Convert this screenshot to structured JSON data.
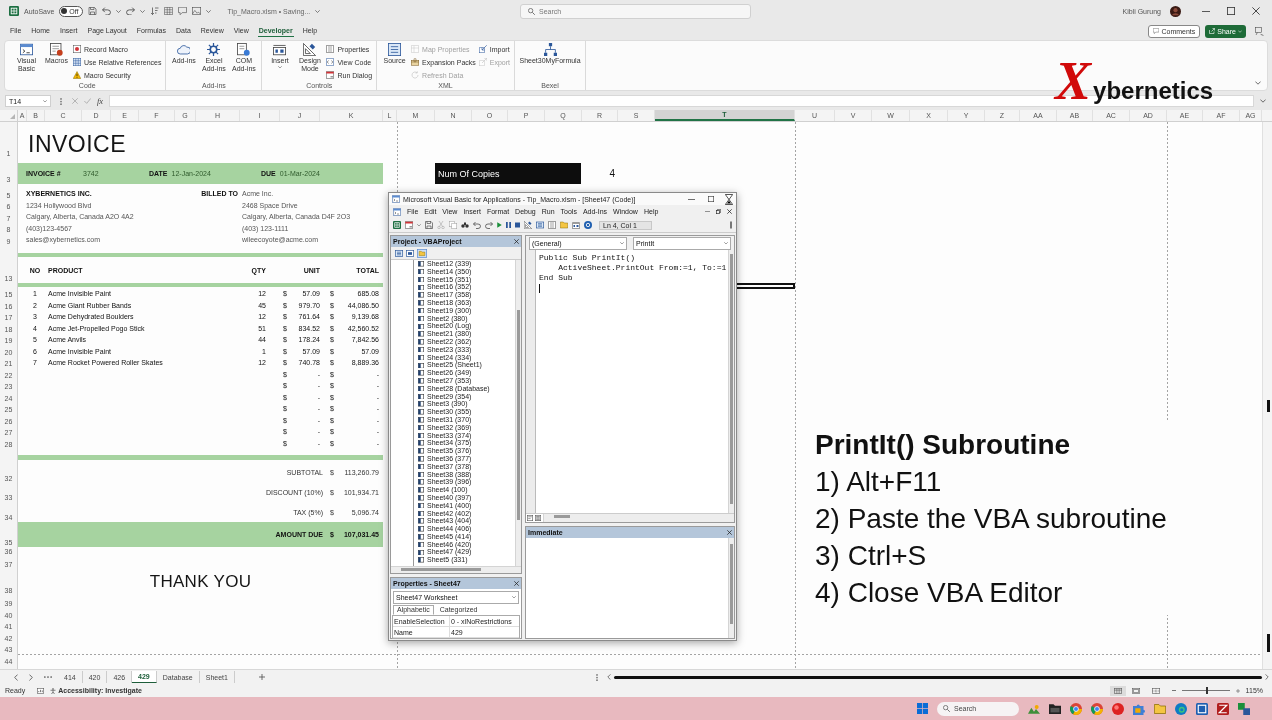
{
  "title_bar": {
    "autosave": {
      "label": "AutoSave",
      "state": "Off",
      "on": false
    },
    "document_title": "Tip_Macro.xlsm • Saving...",
    "search": {
      "placeholder": "Search"
    },
    "user_name": "Kibli Gurung"
  },
  "ribbon": {
    "tabs": [
      {
        "label": "File",
        "selected": false
      },
      {
        "label": "Home",
        "selected": false
      },
      {
        "label": "Insert",
        "selected": false
      },
      {
        "label": "Page Layout",
        "selected": false
      },
      {
        "label": "Formulas",
        "selected": false
      },
      {
        "label": "Data",
        "selected": false
      },
      {
        "label": "Review",
        "selected": false
      },
      {
        "label": "View",
        "selected": false
      },
      {
        "label": "Developer",
        "selected": true
      },
      {
        "label": "Help",
        "selected": false
      }
    ],
    "comments_button": "Comments",
    "share_button": "Share",
    "groups": [
      {
        "label": "Code",
        "items": [
          {
            "kind": "large",
            "label": "Visual Basic",
            "disabled": false
          },
          {
            "kind": "large",
            "label": "Macros",
            "disabled": false
          },
          {
            "kind": "small",
            "label": "Record Macro",
            "disabled": false
          },
          {
            "kind": "small",
            "label": "Use Relative References",
            "disabled": false
          },
          {
            "kind": "small",
            "label": "Macro Security",
            "disabled": false
          }
        ]
      },
      {
        "label": "Add-ins",
        "items": [
          {
            "kind": "large",
            "label": "Add-ins",
            "disabled": false
          },
          {
            "kind": "large",
            "label": "Excel Add-ins",
            "disabled": false
          },
          {
            "kind": "large",
            "label": "COM Add-ins",
            "disabled": false
          }
        ]
      },
      {
        "label": "Controls",
        "items": [
          {
            "kind": "large",
            "label": "Insert",
            "disabled": false
          },
          {
            "kind": "large",
            "label": "Design Mode",
            "disabled": false
          },
          {
            "kind": "small",
            "label": "Properties",
            "disabled": false
          },
          {
            "kind": "small",
            "label": "View Code",
            "disabled": false
          },
          {
            "kind": "small",
            "label": "Run Dialog",
            "disabled": false
          }
        ]
      },
      {
        "label": "XML",
        "items": [
          {
            "kind": "large",
            "label": "Source",
            "disabled": false
          },
          {
            "kind": "small",
            "label": "Map Properties",
            "disabled": true
          },
          {
            "kind": "small",
            "label": "Expansion Packs",
            "disabled": false
          },
          {
            "kind": "small",
            "label": "Refresh Data",
            "disabled": true
          },
          {
            "kind": "small",
            "label": "Import",
            "disabled": false
          },
          {
            "kind": "small",
            "label": "Export",
            "disabled": true
          }
        ]
      },
      {
        "label": "Bexel",
        "items": [
          {
            "kind": "large",
            "label": "Sheet30MyFormula",
            "disabled": false
          }
        ]
      }
    ]
  },
  "formula_bar": {
    "name_box": "T14",
    "function_label": "fx"
  },
  "sheet": {
    "columns": [
      {
        "label": "A",
        "selected": false
      },
      {
        "label": "B",
        "selected": false
      },
      {
        "label": "C",
        "selected": false
      },
      {
        "label": "D",
        "selected": false
      },
      {
        "label": "E",
        "selected": false
      },
      {
        "label": "F",
        "selected": false
      },
      {
        "label": "G",
        "selected": false
      },
      {
        "label": "H",
        "selected": false
      },
      {
        "label": "I",
        "selected": false
      },
      {
        "label": "J",
        "selected": false
      },
      {
        "label": "K",
        "selected": false
      },
      {
        "label": "L",
        "selected": false
      },
      {
        "label": "M",
        "selected": false
      },
      {
        "label": "N",
        "selected": false
      },
      {
        "label": "O",
        "selected": false
      },
      {
        "label": "P",
        "selected": false
      },
      {
        "label": "Q",
        "selected": false
      },
      {
        "label": "R",
        "selected": false
      },
      {
        "label": "S",
        "selected": false
      },
      {
        "label": "T",
        "selected": true
      },
      {
        "label": "U",
        "selected": false
      },
      {
        "label": "V",
        "selected": false
      },
      {
        "label": "W",
        "selected": false
      },
      {
        "label": "X",
        "selected": false
      },
      {
        "label": "Y",
        "selected": false
      },
      {
        "label": "Z",
        "selected": false
      },
      {
        "label": "AA",
        "selected": false
      },
      {
        "label": "AB",
        "selected": false
      },
      {
        "label": "AC",
        "selected": false
      },
      {
        "label": "AD",
        "selected": false
      },
      {
        "label": "AE",
        "selected": false
      },
      {
        "label": "AF",
        "selected": false
      },
      {
        "label": "AG",
        "selected": false
      }
    ],
    "rows": [
      "1",
      "3",
      "5",
      "6",
      "7",
      "8",
      "9",
      "13",
      "15",
      "16",
      "17",
      "18",
      "19",
      "20",
      "21",
      "22",
      "23",
      "24",
      "25",
      "26",
      "27",
      "28",
      "32",
      "33",
      "34",
      "35",
      "36",
      "37",
      "38",
      "39",
      "40",
      "41",
      "42",
      "43",
      "44"
    ],
    "invoice": {
      "title": "INVOICE",
      "meta": [
        {
          "label": "INVOICE #",
          "value": "3742"
        },
        {
          "label": "DATE",
          "value": "12-Jan-2024"
        },
        {
          "label": "DUE",
          "value": "01-Mar-2024"
        }
      ],
      "seller": {
        "name": "XYBERNETICS INC.",
        "lines": [
          "1234 Hollywood Blvd",
          "Calgary, Alberta, Canada A2O 4A2",
          "(403)123-4567",
          "sales@xybernetics.com"
        ]
      },
      "billed_to": {
        "label": "BILLED TO",
        "name": "Acme Inc.",
        "lines": [
          "2468 Space Drive",
          "Calgary, Alberta, Canada D4F 2O3",
          "(403) 123-1111",
          "wileecoyote@acme.com"
        ]
      },
      "columns": [
        "NO",
        "PRODUCT",
        "QTY",
        "UNIT",
        "TOTAL"
      ],
      "items": [
        {
          "no": "1",
          "product": "Acme Invisible Paint",
          "qty": "12",
          "unit_currency": "$",
          "unit": "57.09",
          "total_currency": "$",
          "total": "685.08"
        },
        {
          "no": "2",
          "product": "Acme Giant Rubber Bands",
          "qty": "45",
          "unit_currency": "$",
          "unit": "979.70",
          "total_currency": "$",
          "total": "44,086.50"
        },
        {
          "no": "3",
          "product": "Acme Dehydrated Boulders",
          "qty": "12",
          "unit_currency": "$",
          "unit": "761.64",
          "total_currency": "$",
          "total": "9,139.68"
        },
        {
          "no": "4",
          "product": "Acme Jet-Propelled Pogo Stick",
          "qty": "51",
          "unit_currency": "$",
          "unit": "834.52",
          "total_currency": "$",
          "total": "42,560.52"
        },
        {
          "no": "5",
          "product": "Acme Anvils",
          "qty": "44",
          "unit_currency": "$",
          "unit": "178.24",
          "total_currency": "$",
          "total": "7,842.56"
        },
        {
          "no": "6",
          "product": "Acme Invisible Paint",
          "qty": "1",
          "unit_currency": "$",
          "unit": "57.09",
          "total_currency": "$",
          "total": "57.09"
        },
        {
          "no": "7",
          "product": "Acme Rocket Powered Roller Skates",
          "qty": "12",
          "unit_currency": "$",
          "unit": "740.78",
          "total_currency": "$",
          "total": "8,889.36"
        },
        {
          "unit_currency": "$",
          "unit": "-",
          "total_currency": "$",
          "total": "-"
        },
        {
          "unit_currency": "$",
          "unit": "-",
          "total_currency": "$",
          "total": "-"
        },
        {
          "unit_currency": "$",
          "unit": "-",
          "total_currency": "$",
          "total": "-"
        },
        {
          "unit_currency": "$",
          "unit": "-",
          "total_currency": "$",
          "total": "-"
        },
        {
          "unit_currency": "$",
          "unit": "-",
          "total_currency": "$",
          "total": "-"
        },
        {
          "unit_currency": "$",
          "unit": "-",
          "total_currency": "$",
          "total": "-"
        },
        {
          "unit_currency": "$",
          "unit": "-",
          "total_currency": "$",
          "total": "-"
        }
      ],
      "totals": [
        {
          "label": "SUBTOTAL",
          "currency": "$",
          "value": "113,260.79"
        },
        {
          "label": "DISCOUNT (10%)",
          "currency": "$",
          "value": "101,934.71"
        },
        {
          "label": "TAX (5%)",
          "currency": "$",
          "value": "5,096.74"
        }
      ],
      "amount_due": {
        "label": "AMOUNT DUE",
        "currency": "$",
        "value": "107,031.45"
      },
      "footer": "THANK YOU"
    },
    "copies": {
      "label": "Num Of Copies",
      "value": "4"
    },
    "instructions": {
      "title": "PrintIt() Subroutine",
      "steps": [
        "1) Alt+F11",
        "2) Paste the VBA subroutine",
        "3) Ctrl+S",
        "4) Close VBA Editor"
      ]
    }
  },
  "sheet_tabs": [
    {
      "label": "414",
      "selected": false
    },
    {
      "label": "420",
      "selected": false
    },
    {
      "label": "426",
      "selected": false
    },
    {
      "label": "429",
      "selected": true
    },
    {
      "label": "Database",
      "selected": false
    },
    {
      "label": "Sheet1",
      "selected": false
    }
  ],
  "status_bar": {
    "status": "Ready",
    "accessibility": "Accessibility: Investigate",
    "zoom_slider": {
      "level": 0.52
    },
    "zoom": "115%"
  },
  "vba_editor": {
    "title": "Microsoft Visual Basic for Applications - Tip_Macro.xlsm - [Sheet47 (Code)]",
    "menu": [
      "File",
      "Edit",
      "View",
      "Insert",
      "Format",
      "Debug",
      "Run",
      "Tools",
      "Add-Ins",
      "Window",
      "Help"
    ],
    "position": "Ln 4, Col 1",
    "project": {
      "title": "Project - VBAProject",
      "items": [
        "Sheet12 (339)",
        "Sheet14 (350)",
        "Sheet15 (351)",
        "Sheet16 (352)",
        "Sheet17 (358)",
        "Sheet18 (363)",
        "Sheet19 (300)",
        "Sheet2 (380)",
        "Sheet20 (Log)",
        "Sheet21 (380)",
        "Sheet22 (362)",
        "Sheet23 (333)",
        "Sheet24 (334)",
        "Sheet25 (Sheet1)",
        "Sheet26 (349)",
        "Sheet27 (353)",
        "Sheet28 (Database)",
        "Sheet29 (354)",
        "Sheet3 (390)",
        "Sheet30 (355)",
        "Sheet31 (370)",
        "Sheet32 (369)",
        "Sheet33 (374)",
        "Sheet34 (375)",
        "Sheet35 (376)",
        "Sheet36 (377)",
        "Sheet37 (378)",
        "Sheet38 (388)",
        "Sheet39 (396)",
        "Sheet4 (100)",
        "Sheet40 (397)",
        "Sheet41 (400)",
        "Sheet42 (402)",
        "Sheet43 (404)",
        "Sheet44 (406)",
        "Sheet45 (414)",
        "Sheet46 (420)",
        "Sheet47 (429)",
        "Sheet5 (331)"
      ]
    },
    "properties": {
      "title": "Properties - Sheet47",
      "object": "Sheet47 Worksheet",
      "tabs": [
        {
          "label": "Alphabetic",
          "selected": true
        },
        {
          "label": "Categorized",
          "selected": false
        }
      ],
      "rows": [
        {
          "name": "EnableSelection",
          "value": "0 - xlNoRestrictions"
        },
        {
          "name": "Name",
          "value": "429"
        }
      ]
    },
    "code": {
      "object": "(General)",
      "procedure": "PrintIt",
      "lines": [
        "Public Sub PrintIt()",
        "    ActiveSheet.PrintOut From:=1, To:=1",
        "End Sub"
      ]
    },
    "immediate": {
      "title": "Immediate"
    }
  },
  "logo": {
    "initial": "X",
    "text": "ybernetics"
  },
  "taskbar": {
    "search": {
      "placeholder": "Search"
    }
  }
}
